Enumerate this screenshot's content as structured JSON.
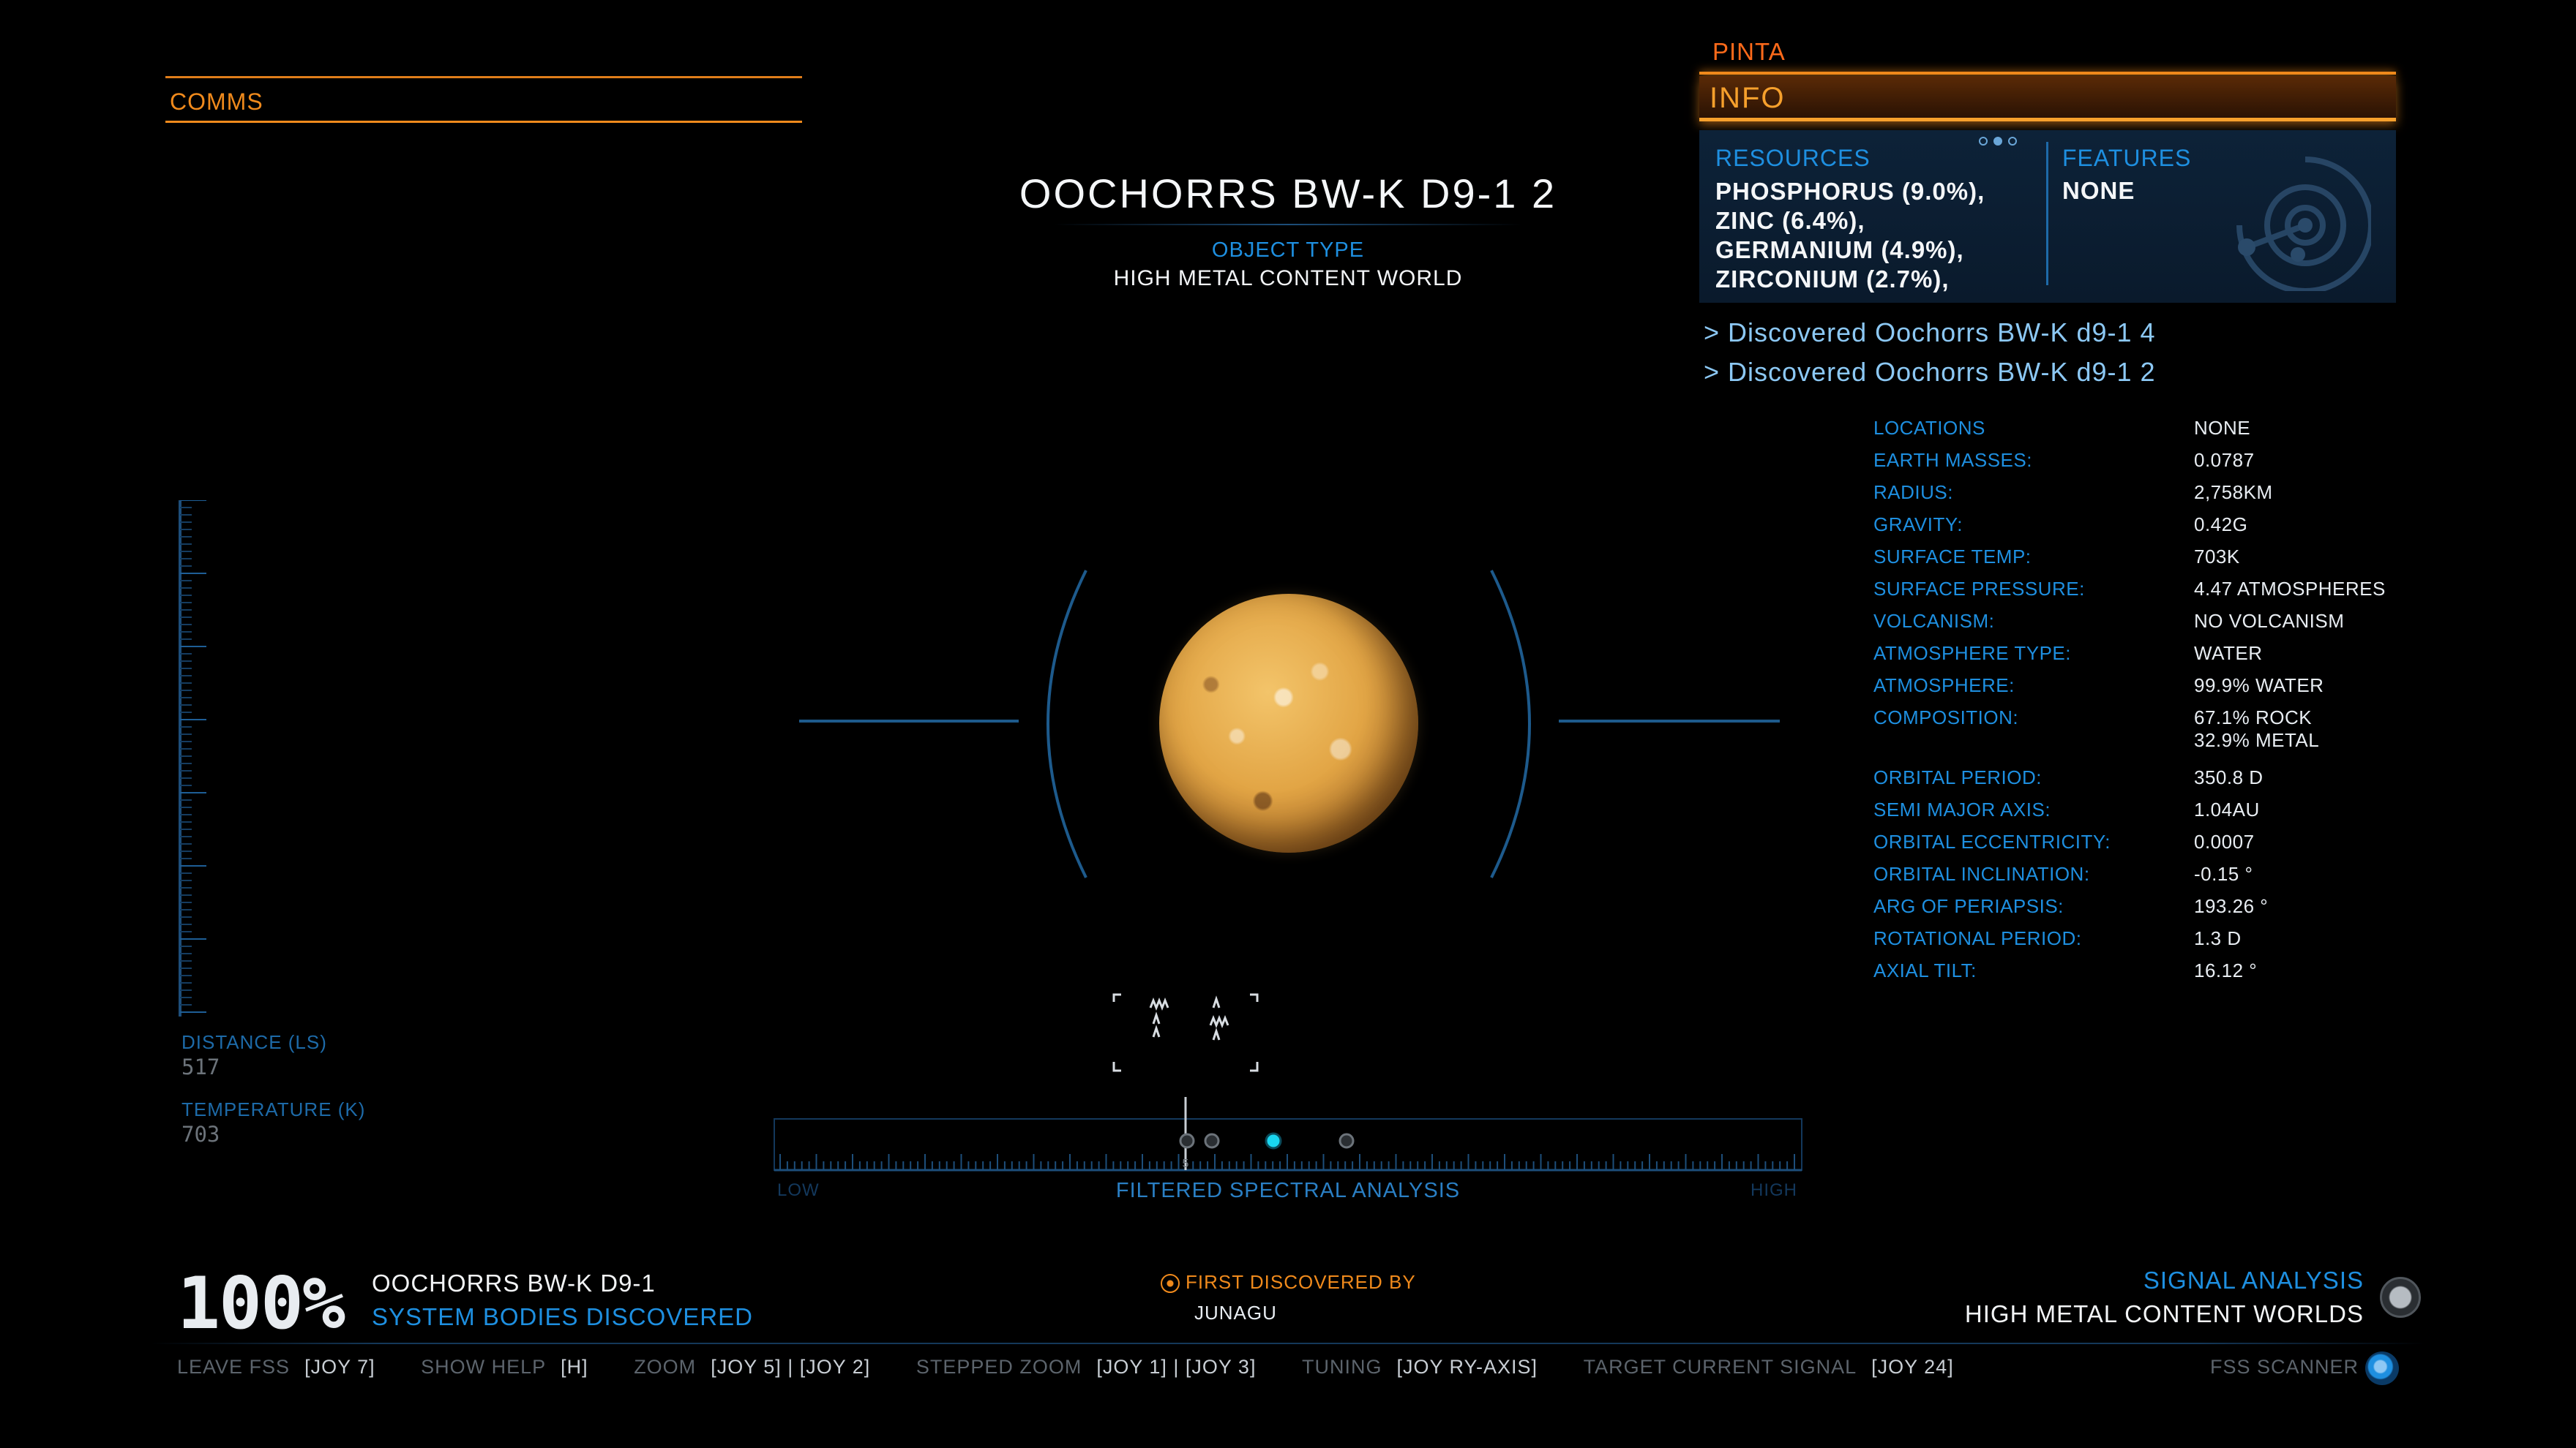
{
  "comms": {
    "label": "COMMS"
  },
  "body": {
    "name": "OOCHORRS BW-K D9-1 2",
    "object_type_label": "OBJECT TYPE",
    "object_type": "HIGH METAL CONTENT WORLD"
  },
  "info_panel": {
    "ship": "PINTA",
    "tab": "INFO",
    "page_dots": 3,
    "page_active": 2,
    "resources_title": "RESOURCES",
    "resources": [
      "PHOSPHORUS (9.0%),",
      "ZINC (6.4%),",
      "GERMANIUM (4.9%),",
      "ZIRCONIUM (2.7%),"
    ],
    "features_title": "FEATURES",
    "features_value": "NONE",
    "features_icon": "scanner-rings-icon"
  },
  "discoveries": [
    "> Discovered Oochorrs BW-K d9-1 4",
    "> Discovered Oochorrs BW-K d9-1 2"
  ],
  "stats": [
    {
      "k": "LOCATIONS",
      "v": "NONE"
    },
    {
      "k": "EARTH MASSES:",
      "v": "0.0787"
    },
    {
      "k": "RADIUS:",
      "v": "2,758KM"
    },
    {
      "k": "GRAVITY:",
      "v": "0.42G"
    },
    {
      "k": "SURFACE TEMP:",
      "v": "703K"
    },
    {
      "k": "SURFACE PRESSURE:",
      "v": "4.47 ATMOSPHERES"
    },
    {
      "k": "VOLCANISM:",
      "v": "NO VOLCANISM"
    },
    {
      "k": "ATMOSPHERE TYPE:",
      "v": "WATER"
    },
    {
      "k": "ATMOSPHERE:",
      "v": "99.9% WATER"
    },
    {
      "k": "COMPOSITION:",
      "v": "67.1% ROCK",
      "v2": "32.9% METAL"
    },
    {
      "k": "ORBITAL PERIOD:",
      "v": "350.8 D"
    },
    {
      "k": "SEMI MAJOR AXIS:",
      "v": "1.04AU"
    },
    {
      "k": "ORBITAL ECCENTRICITY:",
      "v": "0.0007"
    },
    {
      "k": "ORBITAL INCLINATION:",
      "v": "-0.15 °"
    },
    {
      "k": "ARG OF PERIAPSIS:",
      "v": "193.26 °"
    },
    {
      "k": "ROTATIONAL PERIOD:",
      "v": "1.3 D"
    },
    {
      "k": "AXIAL TILT:",
      "v": "16.12 °"
    }
  ],
  "left_readouts": {
    "distance_label": "DISTANCE (LS)",
    "distance_value": "517",
    "temperature_label": "TEMPERATURE (K)",
    "temperature_value": "703"
  },
  "spectral": {
    "low": "LOW",
    "high": "HIGH",
    "label": "FILTERED SPECTRAL ANALYSIS",
    "needle_mark": "5"
  },
  "progress": {
    "percent": "100%",
    "system": "OOCHORRS BW-K D9-1",
    "caption": "SYSTEM BODIES DISCOVERED"
  },
  "first_discovered": {
    "label": "FIRST DISCOVERED BY",
    "name": "JUNAGU"
  },
  "signal": {
    "label": "SIGNAL ANALYSIS",
    "value": "HIGH METAL CONTENT WORLDS"
  },
  "controls": [
    {
      "k": "LEAVE FSS",
      "v": "[JOY 7]"
    },
    {
      "k": "SHOW HELP",
      "v": "[H]"
    },
    {
      "k": "ZOOM",
      "v": "[JOY 5] | [JOY 2]"
    },
    {
      "k": "STEPPED ZOOM",
      "v": "[JOY 1] | [JOY 3]"
    },
    {
      "k": "TUNING",
      "v": "[JOY RY-AXIS]"
    },
    {
      "k": "TARGET CURRENT SIGNAL",
      "v": "[JOY 24]"
    }
  ],
  "fss": {
    "label": "FSS SCANNER",
    "icon": "fss-scanner-icon"
  },
  "colors": {
    "accent_orange": "#f08a1c",
    "accent_blue": "#1e8fe0",
    "active_signal": "#19d6f0"
  }
}
